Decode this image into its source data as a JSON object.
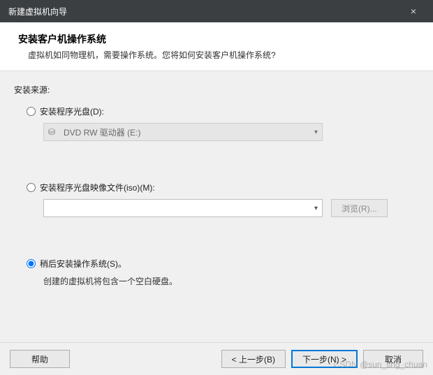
{
  "titlebar": {
    "title": "新建虚拟机向导",
    "close": "×"
  },
  "header": {
    "heading": "安装客户机操作系统",
    "sub": "虚拟机如同物理机，需要操作系统。您将如何安装客户机操作系统?"
  },
  "content": {
    "source_label": "安装来源:",
    "opt_disc": {
      "label": "安装程序光盘(D):",
      "value": "DVD RW 驱动器 (E:)"
    },
    "opt_iso": {
      "label": "安装程序光盘映像文件(iso)(M):",
      "path": "",
      "browse": "浏览(R)..."
    },
    "opt_later": {
      "label": "稍后安装操作系统(S)。",
      "note": "创建的虚拟机将包含一个空白硬盘。"
    }
  },
  "footer": {
    "help": "帮助",
    "back": "< 上一步(B)",
    "next": "下一步(N) >",
    "cancel": "取消"
  },
  "watermark": "CSDN @sun_ting_chuan"
}
